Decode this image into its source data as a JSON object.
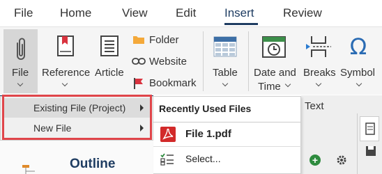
{
  "menubar": {
    "items": [
      {
        "label": "File"
      },
      {
        "label": "Home"
      },
      {
        "label": "View"
      },
      {
        "label": "Edit"
      },
      {
        "label": "Insert"
      },
      {
        "label": "Review"
      }
    ],
    "active": "Insert"
  },
  "ribbon": {
    "file": "File",
    "reference": "Reference",
    "article": "Article",
    "folder": "Folder",
    "website": "Website",
    "bookmark": "Bookmark",
    "table": "Table",
    "date_and": "Date and",
    "time": "Time",
    "breaks": "Breaks",
    "symbol": "Symbol",
    "text_group": "Text"
  },
  "submenu": {
    "items": [
      {
        "label": "Existing File (Project)"
      },
      {
        "label": "New File"
      }
    ]
  },
  "recent": {
    "title": "Recently Used Files",
    "file": "File 1.pdf",
    "select": "Select..."
  },
  "outline": {
    "title": "Outline"
  },
  "colors": {
    "accent": "#1f3d62",
    "highlight_box": "#e0454a"
  }
}
